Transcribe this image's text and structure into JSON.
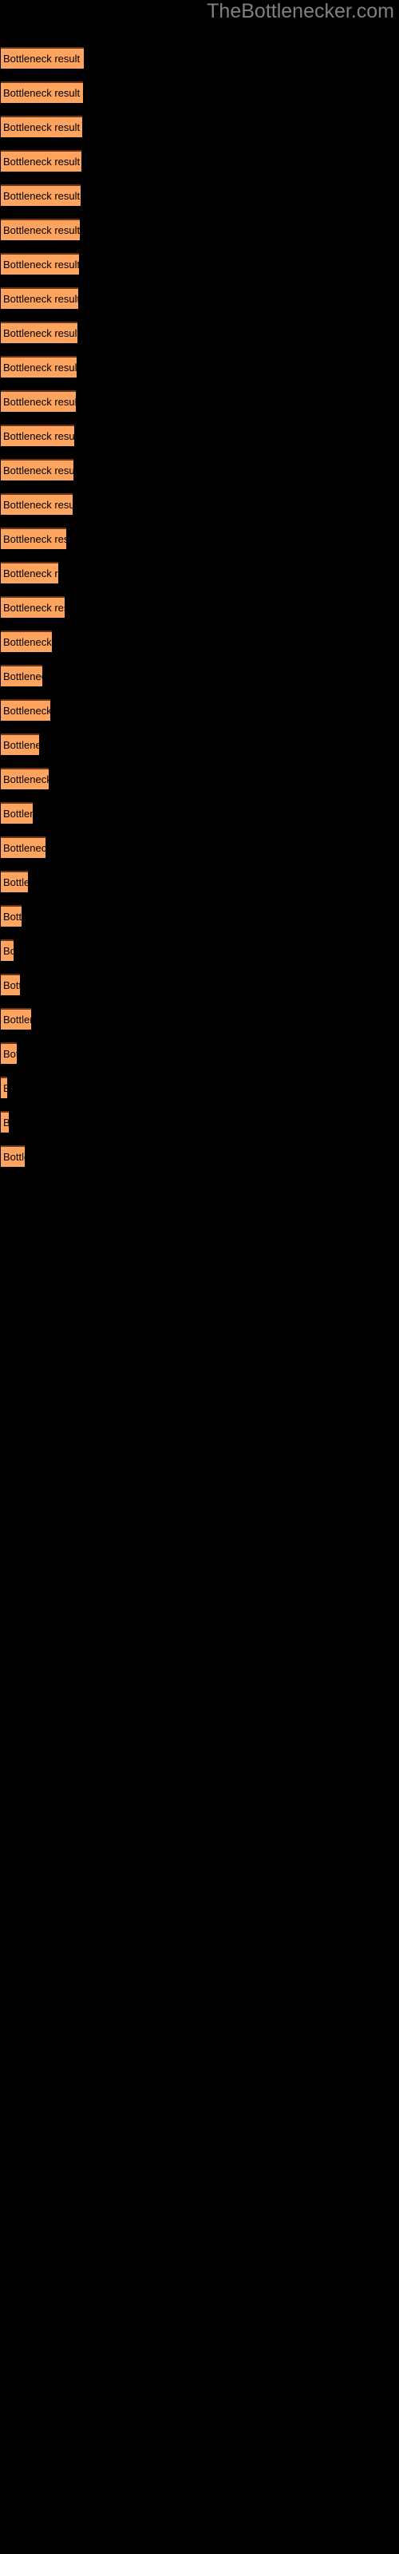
{
  "site": {
    "watermark": "TheBottlenecker.com"
  },
  "chart_data": {
    "type": "bar",
    "orientation": "horizontal",
    "title": "",
    "subtitle": "",
    "xlabel": "",
    "ylabel": "",
    "grid": false,
    "legend": null,
    "background_color": "#000000",
    "bar_fill_color": "#FFA45E",
    "bar_border_color": "#6B3415",
    "label_color": "#000000",
    "watermark_color": "#808080",
    "bar_label_text": "Bottleneck result",
    "xlim": [
      0,
      500
    ],
    "categories": [
      "Bottleneck result",
      "Bottleneck result",
      "Bottleneck result",
      "Bottleneck result",
      "Bottleneck result",
      "Bottleneck result",
      "Bottleneck result",
      "Bottleneck result",
      "Bottleneck result",
      "Bottleneck result",
      "Bottleneck result",
      "Bottleneck result",
      "Bottleneck result",
      "Bottleneck result",
      "Bottleneck result",
      "Bottleneck result",
      "Bottleneck result",
      "Bottleneck result",
      "Bottleneck result",
      "Bottleneck result",
      "Bottleneck result",
      "Bottleneck result",
      "Bottleneck result",
      "Bottleneck result",
      "Bottleneck result",
      "Bottleneck result",
      "Bottleneck result",
      "Bottleneck result",
      "Bottleneck result",
      "Bottleneck result",
      "Bottleneck result",
      "Bottleneck result",
      "Bottleneck result"
    ],
    "values": [
      104,
      103,
      102,
      101,
      100,
      99,
      98,
      97,
      96,
      95,
      94,
      92,
      91,
      90,
      82,
      72,
      80,
      64,
      52,
      62,
      48,
      60,
      40,
      56,
      34,
      26,
      16,
      24,
      38,
      20,
      8,
      10,
      30
    ],
    "bar_tops": [
      59,
      102,
      145,
      188,
      231,
      274,
      317,
      360,
      403,
      446,
      489,
      532,
      575,
      618,
      661,
      704,
      747,
      790,
      833,
      876,
      919,
      962,
      1005,
      1048,
      1091,
      1134,
      1177,
      1220,
      1263,
      1306,
      1349,
      1392,
      1435
    ]
  }
}
